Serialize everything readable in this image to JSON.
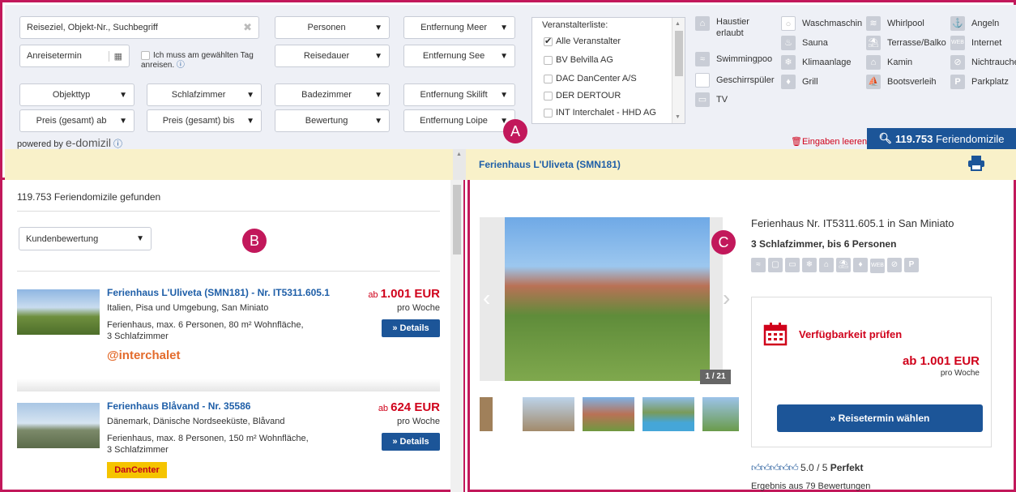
{
  "search": {
    "destination_placeholder": "Reiseziel, Objekt-Nr., Suchbegriff",
    "arrival_placeholder": "Anreisetermin",
    "exact_day_label": "Ich muss am gewählten Tag anreisen.",
    "persons": "Personen",
    "duration": "Reisedauer",
    "object_type": "Objekttyp",
    "bedrooms": "Schlafzimmer",
    "bathrooms": "Badezimmer",
    "price_from": "Preis (gesamt) ab",
    "price_to": "Preis (gesamt) bis",
    "rating": "Bewertung",
    "dist_sea": "Entfernung Meer",
    "dist_lake": "Entfernung See",
    "dist_ski": "Entfernung Skilift",
    "dist_trail": "Entfernung Loipe"
  },
  "operators": {
    "heading": "Veranstalterliste:",
    "items": [
      {
        "label": "Alle Veranstalter",
        "checked": true
      },
      {
        "label": "BV Belvilla AG",
        "checked": false
      },
      {
        "label": "DAC DanCenter A/S",
        "checked": false
      },
      {
        "label": "DER DERTOUR",
        "checked": false
      },
      {
        "label": "INT Interchalet - HHD AG",
        "checked": false
      }
    ]
  },
  "amenities": {
    "col1": [
      "Haustier erlaubt",
      "Swimmingpoo",
      "Geschirrspüler",
      "TV"
    ],
    "col2": [
      "Waschmaschin",
      "Sauna",
      "Klimaanlage",
      "Grill"
    ],
    "col3": [
      "Whirlpool",
      "Terrasse/Balko",
      "Kamin",
      "Bootsverleih"
    ],
    "col4": [
      "Angeln",
      "Internet",
      "Nichtrauche",
      "Parkplatz"
    ]
  },
  "powered": {
    "prefix": "powered by",
    "brand": "e-domizil"
  },
  "actions": {
    "clear": "Eingaben leeren",
    "search_count": "119.753",
    "search_suffix": "Feriendomizile"
  },
  "selected_title": "Ferienhaus L'Uliveta (SMN181)",
  "markers": {
    "a": "A",
    "b": "B",
    "c": "C"
  },
  "results": {
    "count_text": "119.753 Feriendomizile gefunden",
    "sort": "Kundenbewertung",
    "items": [
      {
        "title": "Ferienhaus L'Uliveta (SMN181) - Nr. IT5311.605.1",
        "location": "Italien, Pisa und Umgebung, San Miniato",
        "desc": "Ferienhaus, max. 6 Personen, 80 m² Wohnfläche, 3 Schlafzimmer",
        "price_prefix": "ab",
        "price": "1.001 EUR",
        "period": "pro Woche",
        "details": "Details",
        "logo": "interchalet"
      },
      {
        "title": "Ferienhaus Blåvand - Nr. 35586",
        "location": "Dänemark, Dänische Nordseeküste, Blåvand",
        "desc": "Ferienhaus, max. 8 Personen, 150 m² Wohnfläche, 3 Schlafzimmer",
        "price_prefix": "ab",
        "price": "624 EUR",
        "period": "pro Woche",
        "details": "Details",
        "logo": "DanCenter"
      }
    ]
  },
  "detail": {
    "heading": "Ferienhaus Nr. IT5311.605.1 in San Miniato",
    "sub": "3 Schlafzimmer, bis 6 Personen",
    "photo_counter": "1 / 21",
    "avail_title": "Verfügbarkeit prüfen",
    "price": "ab 1.001 EUR",
    "period": "pro Woche",
    "book_btn": "Reisetermin wählen",
    "rating_value": "5.0 / 5",
    "rating_word": "Perfekt",
    "rating_count": "Ergebnis aus 79 Bewertungen"
  },
  "colors": {
    "accent": "#c2185b",
    "primary": "#1c5598",
    "price": "#d0021b"
  }
}
